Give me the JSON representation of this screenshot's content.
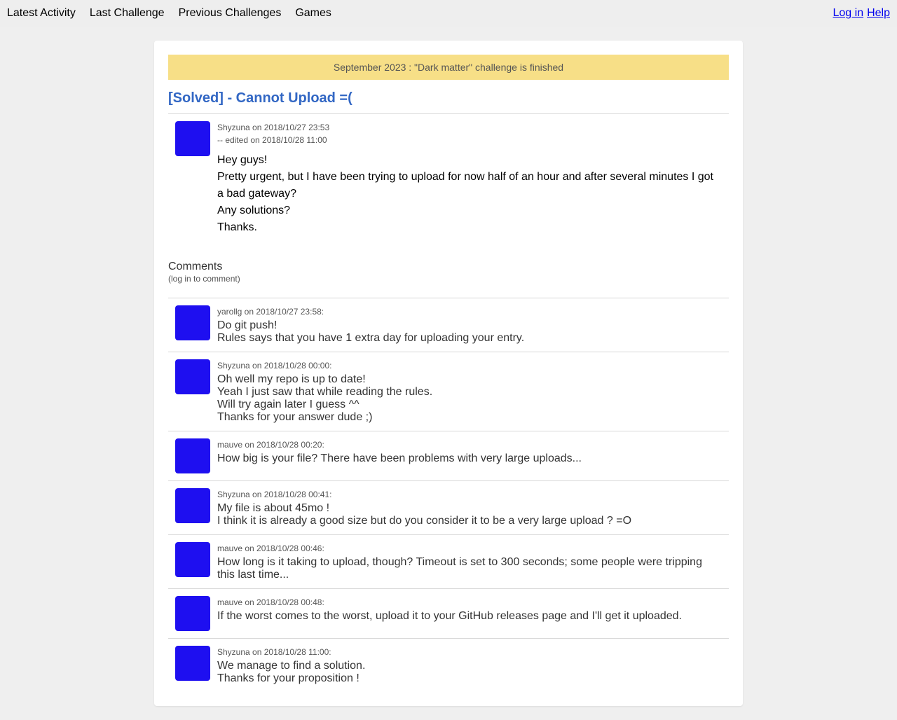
{
  "nav": {
    "left": [
      {
        "label": "Latest Activity"
      },
      {
        "label": "Last Challenge"
      },
      {
        "label": "Previous Challenges"
      },
      {
        "label": "Games"
      }
    ],
    "login": "Log in",
    "help": "Help"
  },
  "banner": {
    "text": "September 2023 : \"Dark matter\" challenge is finished",
    "color": "#f7df87"
  },
  "post": {
    "title": "[Solved] - Cannot Upload =(",
    "title_color": "#3267c4",
    "meta_author": "Shyzuna on 2018/10/27 23:53",
    "meta_edited": "-- edited on 2018/10/28 11:00",
    "lines": [
      "Hey guys!",
      "Pretty urgent, but I have been trying to upload for now half of an hour and after several minutes I got a bad gateway?",
      "Any solutions?",
      "Thanks."
    ]
  },
  "comments": {
    "heading": "Comments",
    "subheading": "(log in to comment)",
    "avatar_color": "#1e0ff0",
    "items": [
      {
        "meta": "yarollg on 2018/10/27 23:58:",
        "lines": [
          "Do git push!",
          "Rules says that you have 1 extra day for uploading your entry."
        ]
      },
      {
        "meta": "Shyzuna on 2018/10/28 00:00:",
        "lines": [
          "Oh well my repo is up to date!",
          "Yeah I just saw that while reading the rules.",
          "Will try again later I guess ^^",
          "Thanks for your answer dude ;)"
        ]
      },
      {
        "meta": "mauve on 2018/10/28 00:20:",
        "lines": [
          "How big is your file? There have been problems with very large uploads..."
        ]
      },
      {
        "meta": "Shyzuna on 2018/10/28 00:41:",
        "lines": [
          "My file is about 45mo !",
          "I think it is already a good size but do you consider it to be a very large upload ? =O"
        ]
      },
      {
        "meta": "mauve on 2018/10/28 00:46:",
        "lines": [
          "How long is it taking to upload, though? Timeout is set to 300 seconds; some people were tripping this last time..."
        ]
      },
      {
        "meta": "mauve on 2018/10/28 00:48:",
        "lines": [
          "If the worst comes to the worst, upload it to your GitHub releases page and I'll get it uploaded."
        ]
      },
      {
        "meta": "Shyzuna on 2018/10/28 11:00:",
        "lines": [
          "We manage to find a solution.",
          "Thanks for your proposition !"
        ]
      }
    ]
  }
}
